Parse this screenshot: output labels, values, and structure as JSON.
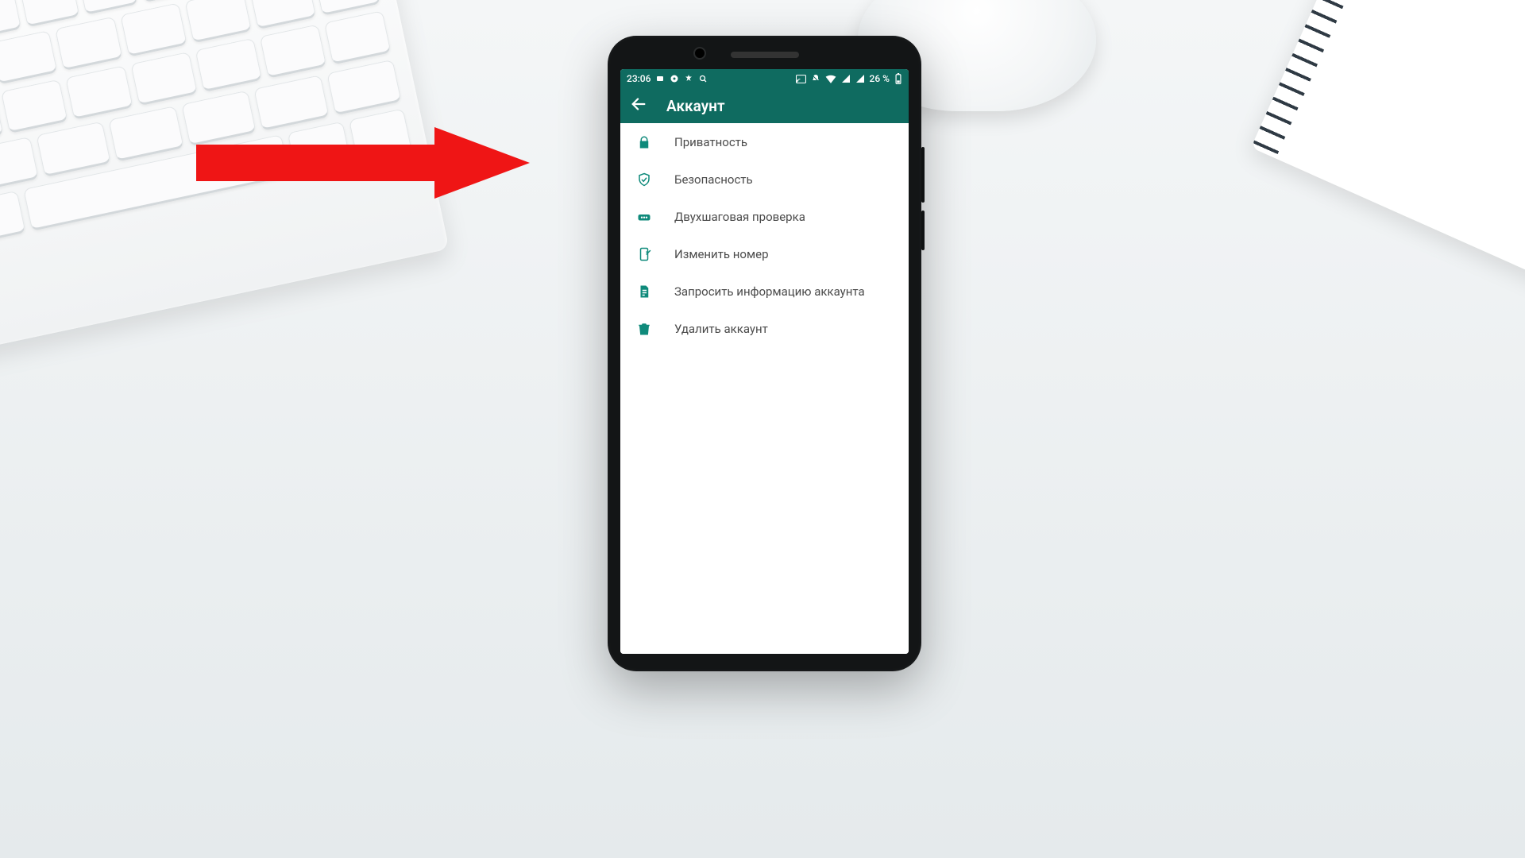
{
  "statusbar": {
    "time": "23:06",
    "battery_text": "26 %"
  },
  "header": {
    "title": "Аккаунт"
  },
  "menu": {
    "items": [
      {
        "icon": "lock-icon",
        "label": "Приватность"
      },
      {
        "icon": "shield-icon",
        "label": "Безопасность"
      },
      {
        "icon": "dots-icon",
        "label": "Двухшаговая проверка"
      },
      {
        "icon": "sim-icon",
        "label": "Изменить номер"
      },
      {
        "icon": "file-icon",
        "label": "Запросить информацию аккаунта"
      },
      {
        "icon": "trash-icon",
        "label": "Удалить аккаунт"
      }
    ]
  },
  "colors": {
    "accent": "#0f6b60",
    "icon": "#0f8a7b",
    "arrow": "#ef1515"
  }
}
